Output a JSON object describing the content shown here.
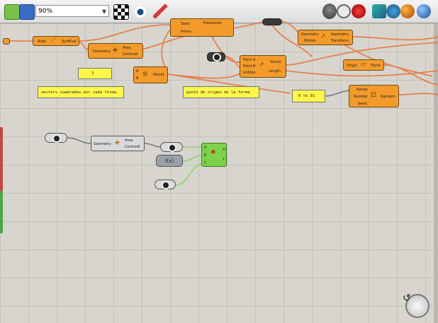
{
  "toolbar": {
    "zoom_value": "90%",
    "icons": [
      "open-file-icon",
      "save-file-icon",
      "zoom-select",
      "fit-view-icon",
      "eye-preview-icon",
      "sketch-pen-icon",
      "rhino-icon",
      "disable-preview-icon",
      "record-icon",
      "shaded-preview-icon",
      "wireframe-preview-icon",
      "rendered-preview-icon",
      "globe-icon"
    ]
  },
  "nodes": {
    "seed_population": {
      "in1": "Seed",
      "in2": "Points",
      "out": "Population"
    },
    "align_surface": {
      "in": "Align",
      "out": "SurfEval"
    },
    "area_top": {
      "in": "Geometry",
      "out1": "Area",
      "out2": "Centroid"
    },
    "geometry_transform": {
      "in1": "Geometry",
      "in2": "Motion",
      "out1": "Geometry",
      "out2": "Transform"
    },
    "vector_2pt": {
      "in1": "Point A",
      "in2": "Point B",
      "in3": "Unitize",
      "out1": "Vector",
      "out2": "Length"
    },
    "plane_origin": {
      "in": "Origin",
      "out": "Plane"
    },
    "multiply": {
      "in1": "A",
      "in2": "B",
      "out": "Result"
    },
    "random": {
      "in1": "Range",
      "in2": "Number",
      "in3": "Seed",
      "out": "Random"
    },
    "area_mid": {
      "in": "Geometry",
      "out1": "Area",
      "out2": "Centroid"
    },
    "merge_green": {
      "in1": "A",
      "in2": "B",
      "in3": "C",
      "out1": "X",
      "out2": "Y"
    },
    "expression": {
      "label": "f(x)"
    }
  },
  "panels": {
    "value_panel": "3",
    "vectors_note": "vectors cuadrados por cada forma.",
    "origin_note": "punto de origen de la forma",
    "range_panel": "0 to 91"
  }
}
